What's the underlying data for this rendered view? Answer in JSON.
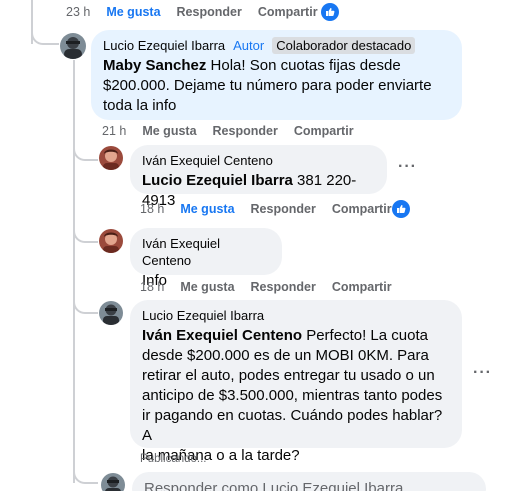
{
  "top_actions": {
    "time": "23 h",
    "like": "Me gusta",
    "reply": "Responder",
    "share": "Compartir"
  },
  "comments": [
    {
      "author": "Lucio Ezequiel Ibarra",
      "badge_author": "Autor",
      "badge_top": "Colaborador destacado",
      "mention": "Maby Sanchez",
      "text_lines": [
        " Hola! Son cuotas fijas desde",
        "$200.000. Dejame tu número para poder enviarte",
        "toda la info"
      ],
      "actions": {
        "time": "21 h",
        "like": "Me gusta",
        "reply": "Responder",
        "share": "Compartir"
      }
    },
    {
      "author": "Iván Exequiel Centeno",
      "mention": "Lucio Ezequiel Ibarra",
      "text": " 381 220-4913",
      "actions": {
        "time": "18 h",
        "like": "Me gusta",
        "reply": "Responder",
        "share": "Compartir"
      }
    },
    {
      "author": "Iván Exequiel Centeno",
      "text": "Info",
      "actions": {
        "time": "18 h",
        "like": "Me gusta",
        "reply": "Responder",
        "share": "Compartir"
      }
    },
    {
      "author": "Lucio Ezequiel Ibarra",
      "mention": "Iván Exequiel Centeno",
      "text_lines": [
        " Perfecto! La cuota",
        "desde $200.000 es de un MOBI 0KM. Para",
        "retirar el auto, podes entregar tu usado o un",
        "anticipo de $3.500.000, mientras tanto podes",
        "ir pagando en cuotas. Cuándo podes hablar? A",
        "la mañana o a la tarde?"
      ]
    }
  ],
  "publishing": "Publicando...",
  "reply_placeholder": "Responder como Lucio Ezequiel Ibarra",
  "colors": {
    "accent": "#1877f2",
    "bubble": "#f0f2f5",
    "highlight": "#e7f3ff"
  },
  "icons": {
    "like": "thumbs-up-icon",
    "more": "more-icon"
  }
}
